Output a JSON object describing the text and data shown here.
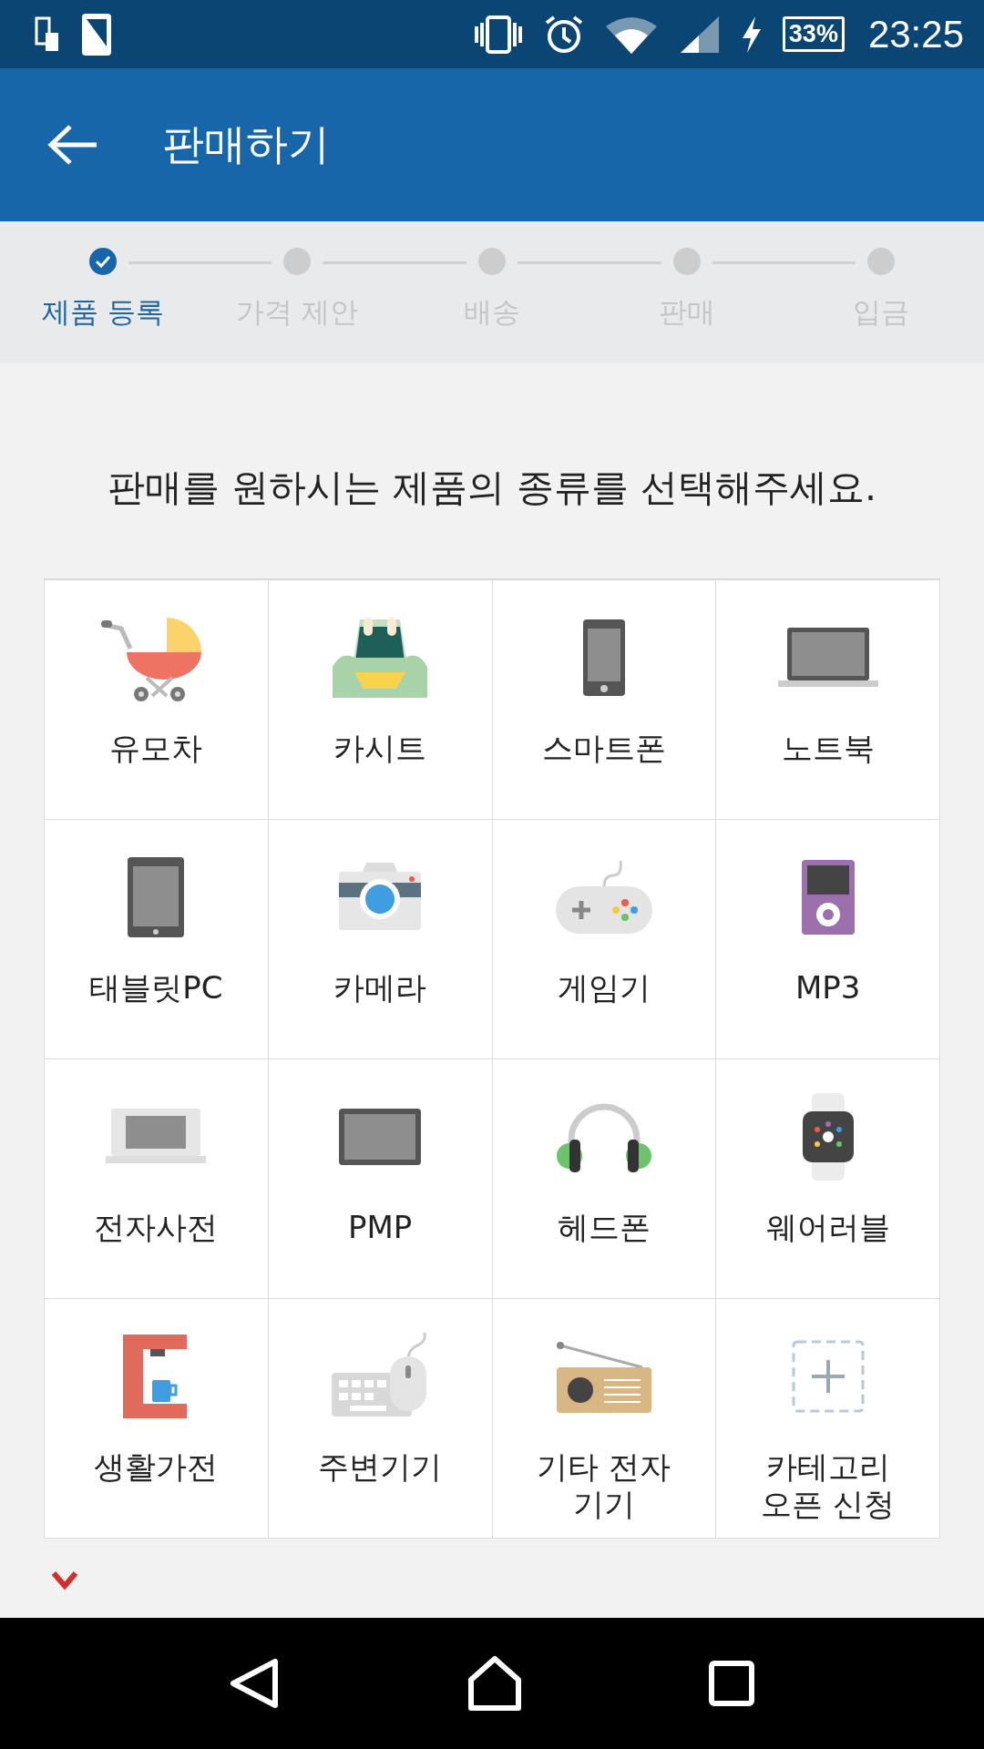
{
  "status_bar": {
    "battery": "33%",
    "time": "23:25"
  },
  "app_bar": {
    "title": "판매하기"
  },
  "steps": [
    {
      "label": "제품 등록",
      "done": true
    },
    {
      "label": "가격 제안",
      "done": false
    },
    {
      "label": "배송",
      "done": false
    },
    {
      "label": "판매",
      "done": false
    },
    {
      "label": "입금",
      "done": false
    }
  ],
  "prompt": "판매를 원하시는 제품의 종류를 선택해주세요.",
  "categories": [
    {
      "label": "유모차"
    },
    {
      "label": "카시트"
    },
    {
      "label": "스마트폰"
    },
    {
      "label": "노트북"
    },
    {
      "label": "태블릿PC"
    },
    {
      "label": "카메라"
    },
    {
      "label": "게임기"
    },
    {
      "label": "MP3"
    },
    {
      "label": "전자사전"
    },
    {
      "label": "PMP"
    },
    {
      "label": "헤드폰"
    },
    {
      "label": "웨어러블"
    },
    {
      "label": "생활가전"
    },
    {
      "label": "주변기기"
    },
    {
      "label": "기타 전자기기"
    },
    {
      "label": "카테고리 오픈 신청"
    }
  ]
}
